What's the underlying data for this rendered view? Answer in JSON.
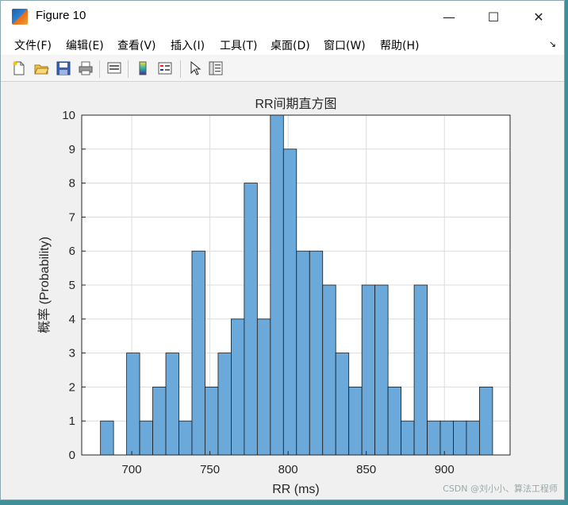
{
  "window": {
    "title": "Figure 10",
    "minimize_glyph": "—",
    "maximize_glyph": "☐",
    "close_glyph": "✕"
  },
  "menu": {
    "items": [
      "文件(F)",
      "编辑(E)",
      "查看(V)",
      "插入(I)",
      "工具(T)",
      "桌面(D)",
      "窗口(W)",
      "帮助(H)"
    ],
    "overflow_glyph": "↘"
  },
  "toolbar": {
    "icons": [
      "new-figure-icon",
      "open-file-icon",
      "save-icon",
      "print-icon",
      "link-plot-icon",
      "colorbar-icon",
      "legend-icon",
      "pointer-icon",
      "property-inspector-icon"
    ]
  },
  "watermark": "CSDN @刘小小、算法工程师",
  "colors": {
    "bar_fill": "#6aa9d9",
    "bar_edge": "#1a1a1a",
    "axes_bg": "#ffffff",
    "grid": "#dcdcdc"
  },
  "chart_data": {
    "type": "bar",
    "title": "RR间期直方图",
    "xlabel": "RR (ms)",
    "ylabel": "概率 (Probability)",
    "xlim": [
      668,
      942
    ],
    "ylim": [
      0,
      10
    ],
    "xticks": [
      700,
      750,
      800,
      850,
      900
    ],
    "yticks": [
      0,
      1,
      2,
      3,
      4,
      5,
      6,
      7,
      8,
      9,
      10
    ],
    "grid": true,
    "bin_width": 8.36,
    "bin_edges": [
      680.0,
      688.36,
      696.72,
      705.08,
      713.44,
      721.8,
      730.16,
      738.52,
      746.88,
      755.24,
      763.6,
      771.96,
      780.32,
      788.68,
      797.04,
      805.4,
      813.76,
      822.12,
      830.48,
      838.84,
      847.2,
      855.56,
      863.92,
      872.28,
      880.64,
      889.0,
      897.36,
      905.72,
      914.08,
      922.44,
      930.8,
      939.16
    ],
    "counts": [
      1,
      0,
      3,
      1,
      2,
      3,
      1,
      6,
      2,
      3,
      4,
      8,
      4,
      10,
      9,
      6,
      6,
      5,
      3,
      2,
      5,
      5,
      2,
      1,
      5,
      1,
      1,
      1,
      1,
      2
    ]
  }
}
